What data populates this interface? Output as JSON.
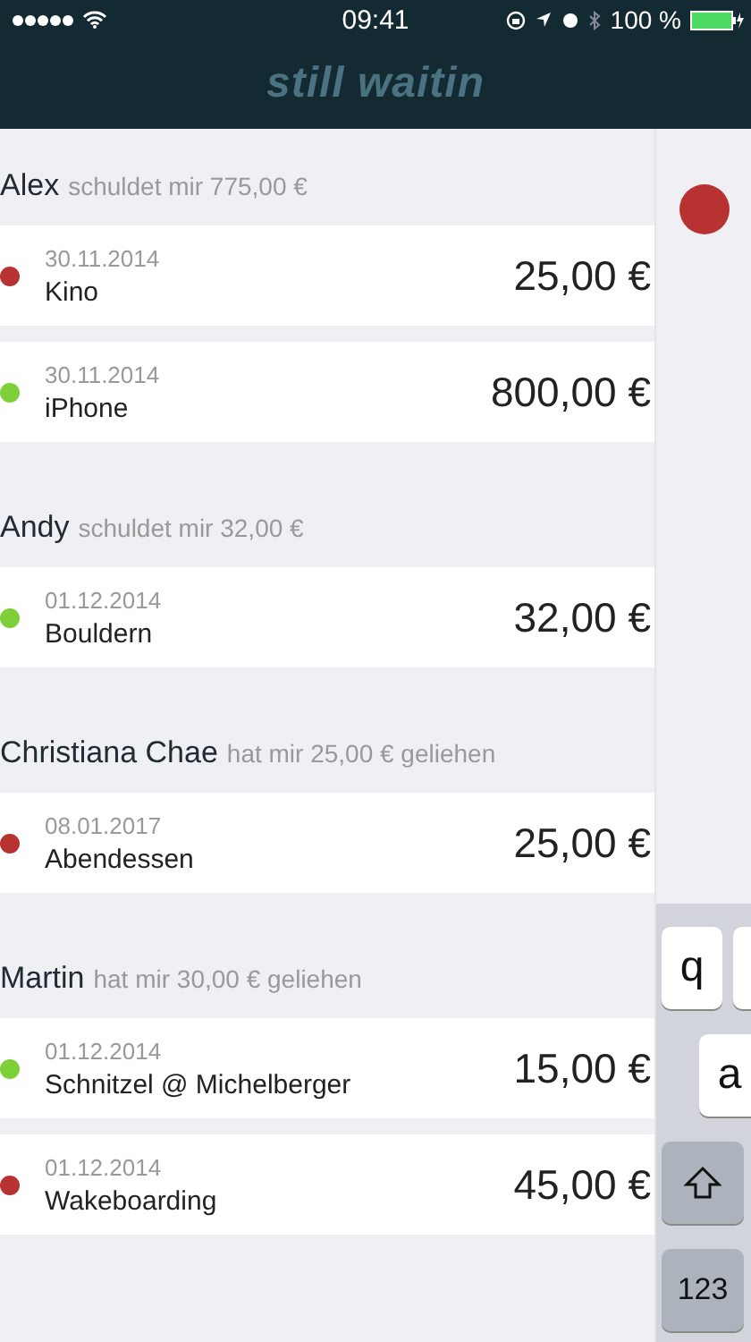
{
  "status_bar": {
    "time": "09:41",
    "battery": "100 %"
  },
  "nav": {
    "title": "still waitin"
  },
  "sections": [
    {
      "name": "Alex",
      "summary": "schuldet mir 775,00 €",
      "entries": [
        {
          "date": "30.11.2014",
          "title": "Kino",
          "amount": "25,00 €",
          "color": "#b83232"
        },
        {
          "date": "30.11.2014",
          "title": "iPhone",
          "amount": "800,00 €",
          "color": "#7ed03a"
        }
      ]
    },
    {
      "name": "Andy",
      "summary": "schuldet mir 32,00 €",
      "entries": [
        {
          "date": "01.12.2014",
          "title": "Bouldern",
          "amount": "32,00 €",
          "color": "#7ed03a"
        }
      ]
    },
    {
      "name": "Christiana Chae",
      "summary": "hat mir 25,00 € geliehen",
      "entries": [
        {
          "date": "08.01.2017",
          "title": "Abendessen",
          "amount": "25,00 €",
          "color": "#b83232"
        }
      ]
    },
    {
      "name": "Martin",
      "summary": "hat mir 30,00 € geliehen",
      "entries": [
        {
          "date": "01.12.2014",
          "title": "Schnitzel @ Michelberger",
          "amount": "15,00 €",
          "color": "#7ed03a"
        },
        {
          "date": "01.12.2014",
          "title": "Wakeboarding",
          "amount": "45,00 €",
          "color": "#b83232"
        }
      ]
    }
  ],
  "side_panel": {
    "color": "#b83232"
  },
  "keyboard": {
    "keys": [
      {
        "label": "q",
        "kind": "letter"
      },
      {
        "label": "a",
        "kind": "letter"
      },
      {
        "kind": "shift"
      },
      {
        "label": "123",
        "kind": "mode"
      }
    ]
  }
}
